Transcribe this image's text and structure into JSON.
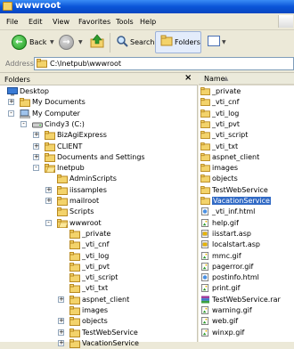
{
  "window": {
    "title": "wwwroot"
  },
  "menu": [
    "File",
    "Edit",
    "View",
    "Favorites",
    "Tools",
    "Help"
  ],
  "toolbar": {
    "back_label": "Back",
    "search_label": "Search",
    "folders_label": "Folders"
  },
  "address": {
    "label": "Address",
    "value": "C:\\Inetpub\\wwwroot"
  },
  "folders_pane": {
    "title": "Folders",
    "tree": [
      {
        "label": "Desktop",
        "icon": "desktop-icon"
      },
      {
        "label": "My Documents",
        "icon": "folder-icon"
      },
      {
        "label": "My Computer",
        "icon": "computer-icon"
      },
      {
        "label": "Cindy3 (C:)",
        "icon": "drive-icon"
      },
      {
        "label": "BizAgiExpress",
        "icon": "folder-icon"
      },
      {
        "label": "CLIENT",
        "icon": "folder-icon"
      },
      {
        "label": "Documents and Settings",
        "icon": "folder-icon"
      },
      {
        "label": "Inetpub",
        "icon": "folder-open-icon"
      },
      {
        "label": "AdminScripts",
        "icon": "folder-icon"
      },
      {
        "label": "iissamples",
        "icon": "folder-icon"
      },
      {
        "label": "mailroot",
        "icon": "folder-icon"
      },
      {
        "label": "Scripts",
        "icon": "folder-icon"
      },
      {
        "label": "wwwroot",
        "icon": "folder-open-icon"
      },
      {
        "label": "_private",
        "icon": "folder-icon"
      },
      {
        "label": "_vti_cnf",
        "icon": "folder-icon"
      },
      {
        "label": "_vti_log",
        "icon": "folder-icon"
      },
      {
        "label": "_vti_pvt",
        "icon": "folder-icon"
      },
      {
        "label": "_vti_script",
        "icon": "folder-icon"
      },
      {
        "label": "_vti_txt",
        "icon": "folder-icon"
      },
      {
        "label": "aspnet_client",
        "icon": "folder-icon"
      },
      {
        "label": "images",
        "icon": "folder-icon"
      },
      {
        "label": "objects",
        "icon": "folder-icon"
      },
      {
        "label": "TestWebService",
        "icon": "folder-icon"
      },
      {
        "label": "VacationService",
        "icon": "folder-icon"
      }
    ]
  },
  "files_pane": {
    "column_name": "Name",
    "sort_indicator": "▲",
    "selected_item": "VacationService",
    "items": [
      {
        "name": "_private",
        "icon": "folder-icon"
      },
      {
        "name": "_vti_cnf",
        "icon": "folder-icon"
      },
      {
        "name": "_vti_log",
        "icon": "folder-icon"
      },
      {
        "name": "_vti_pvt",
        "icon": "folder-icon"
      },
      {
        "name": "_vti_script",
        "icon": "folder-icon"
      },
      {
        "name": "_vti_txt",
        "icon": "folder-icon"
      },
      {
        "name": "aspnet_client",
        "icon": "folder-icon"
      },
      {
        "name": "images",
        "icon": "folder-icon"
      },
      {
        "name": "objects",
        "icon": "folder-icon"
      },
      {
        "name": "TestWebService",
        "icon": "folder-icon"
      },
      {
        "name": "VacationService",
        "icon": "folder-icon"
      },
      {
        "name": "_vti_inf.html",
        "icon": "html-file-icon"
      },
      {
        "name": "help.gif",
        "icon": "image-file-icon"
      },
      {
        "name": "iisstart.asp",
        "icon": "asp-file-icon"
      },
      {
        "name": "localstart.asp",
        "icon": "asp-file-icon"
      },
      {
        "name": "mmc.gif",
        "icon": "image-file-icon"
      },
      {
        "name": "pagerror.gif",
        "icon": "image-file-icon"
      },
      {
        "name": "postinfo.html",
        "icon": "html-file-icon"
      },
      {
        "name": "print.gif",
        "icon": "image-file-icon"
      },
      {
        "name": "TestWebService.rar",
        "icon": "rar-file-icon"
      },
      {
        "name": "warning.gif",
        "icon": "image-file-icon"
      },
      {
        "name": "web.gif",
        "icon": "image-file-icon"
      },
      {
        "name": "winxp.gif",
        "icon": "image-file-icon"
      }
    ]
  },
  "colors": {
    "title_bar": "#0a55d8",
    "selection": "#316ac5",
    "folder": "#f3d36b"
  }
}
